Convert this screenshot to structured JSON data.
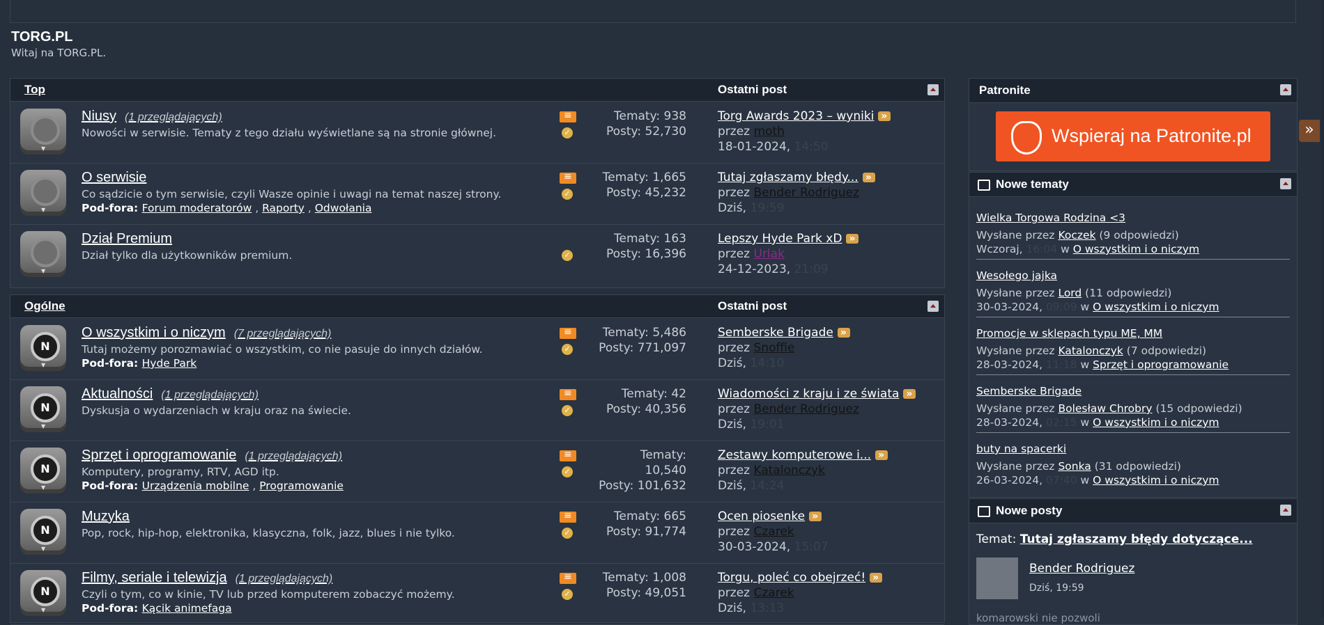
{
  "site": {
    "title": "TORG.PL",
    "subtitle": "Witaj na TORG.PL."
  },
  "sections": [
    {
      "title": "Top",
      "last_post_header": "Ostatni post",
      "forums": [
        {
          "name": "Niusy",
          "viewers": "(1 przeglądających)",
          "desc": "Nowości w serwisie. Tematy z tego działu wyświetlane są na stronie głównej.",
          "subforums_label": "",
          "subforums": [],
          "topics": "Tematy: 938",
          "posts": "Posty: 52,730",
          "last_title": "Torg Awards 2023 – wyniki",
          "by": "przez",
          "last_user": "moth",
          "last_date": "18-01-2024,",
          "last_time": "14:50",
          "has_rss": true,
          "new": false
        },
        {
          "name": "O serwisie",
          "viewers": "",
          "desc": "Co sądzicie o tym serwisie, czyli Wasze opinie i uwagi na temat naszej strony.",
          "subforums_label": "Pod-fora:",
          "subforums": [
            "Forum moderatorów",
            "Raporty",
            "Odwołania"
          ],
          "topics": "Tematy: 1,665",
          "posts": "Posty: 45,232",
          "last_title": "Tutaj zgłaszamy błędy...",
          "by": "przez",
          "last_user": "Bender Rodriguez",
          "last_date": "Dziś,",
          "last_time": "19:59",
          "has_rss": true,
          "new": false
        },
        {
          "name": "Dział Premium",
          "viewers": "",
          "desc": "Dział tylko dla użytkowników premium.",
          "subforums_label": "",
          "subforums": [],
          "topics": "Tematy: 163",
          "posts": "Posty: 16,396",
          "last_title": "Lepszy Hyde Park xD",
          "by": "przez",
          "last_user": "Urlak",
          "last_date": "24-12-2023,",
          "last_time": "21:09",
          "has_rss": false,
          "new": false
        }
      ]
    },
    {
      "title": "Ogólne",
      "last_post_header": "Ostatni post",
      "forums": [
        {
          "name": "O wszystkim i o niczym",
          "viewers": "(7 przeglądających)",
          "desc": "Tutaj możemy porozmawiać o wszystkim, co nie pasuje do innych działów.",
          "subforums_label": "Pod-fora:",
          "subforums": [
            "Hyde Park"
          ],
          "topics": "Tematy: 5,486",
          "posts": "Posty: 771,097",
          "last_title": "Semberske Brigade",
          "by": "przez",
          "last_user": "Snoffie",
          "last_date": "Dziś,",
          "last_time": "14:10",
          "has_rss": true,
          "new": true
        },
        {
          "name": "Aktualności",
          "viewers": "(1 przeglądających)",
          "desc": "Dyskusja o wydarzeniach w kraju oraz na świecie.",
          "subforums_label": "",
          "subforums": [],
          "topics": "Tematy: 42",
          "posts": "Posty: 40,356",
          "last_title": "Wiadomości z kraju i ze świata",
          "by": "przez",
          "last_user": "Bender Rodriguez",
          "last_date": "Dziś,",
          "last_time": "19:01",
          "has_rss": true,
          "new": true
        },
        {
          "name": "Sprzęt i oprogramowanie",
          "viewers": "(1 przeglądających)",
          "desc": "Komputery, programy, RTV, AGD itp.",
          "subforums_label": "Pod-fora:",
          "subforums": [
            "Urządzenia mobilne",
            "Programowanie"
          ],
          "topics": "Tematy: 10,540",
          "posts": "Posty: 101,632",
          "last_title": "Zestawy komputerowe i...",
          "by": "przez",
          "last_user": "Katalonczyk",
          "last_date": "Dziś,",
          "last_time": "14:24",
          "has_rss": true,
          "new": true
        },
        {
          "name": "Muzyka",
          "viewers": "",
          "desc": "Pop, rock, hip-hop, elektronika, klasyczna, folk, jazz, blues i nie tylko.",
          "subforums_label": "",
          "subforums": [],
          "topics": "Tematy: 665",
          "posts": "Posty: 91,774",
          "last_title": "Ocen piosenke",
          "by": "przez",
          "last_user": "Czarek",
          "last_date": "30-03-2024,",
          "last_time": "15:07",
          "has_rss": true,
          "new": true
        },
        {
          "name": "Filmy, seriale i telewizja",
          "viewers": "(1 przeglądających)",
          "desc": "Czyli o tym, co w kinie, TV lub przed komputerem zobaczyć możemy.",
          "subforums_label": "Pod-fora:",
          "subforums": [
            "Kącik animefaga"
          ],
          "topics": "Tematy: 1,008",
          "posts": "Posty: 49,051",
          "last_title": "Torgu, poleć co obejrzeć!",
          "by": "przez",
          "last_user": "Czarek",
          "last_date": "Dziś,",
          "last_time": "13:13",
          "has_rss": true,
          "new": true
        }
      ]
    }
  ],
  "sidebar": {
    "patronite": {
      "title": "Patronite",
      "button_label": "Wspieraj na Patronite.pl"
    },
    "new_topics": {
      "title": "Nowe tematy",
      "items": [
        {
          "title": "Wielka Torgowa Rodzina <3",
          "posted_by": "Wysłane przez",
          "user": "Koczek",
          "replies": "(9 odpowiedzi)",
          "date": "Wczoraj,",
          "time": "16:04",
          "in": "w",
          "forum": "O wszystkim i o niczym"
        },
        {
          "title": "Wesołego jajka",
          "posted_by": "Wysłane przez",
          "user": "Lord",
          "replies": "(11 odpowiedzi)",
          "date": "30-03-2024,",
          "time": "09:09",
          "in": "w",
          "forum": "O wszystkim i o niczym"
        },
        {
          "title": "Promocje w sklepach typu ME, MM",
          "posted_by": "Wysłane przez",
          "user": "Katalonczyk",
          "replies": "(7 odpowiedzi)",
          "date": "28-03-2024,",
          "time": "11:18",
          "in": "w",
          "forum": "Sprzęt i oprogramowanie"
        },
        {
          "title": "Semberske Brigade",
          "posted_by": "Wysłane przez",
          "user": "Bolesław Chrobry",
          "replies": "(15 odpowiedzi)",
          "date": "28-03-2024,",
          "time": "02:15",
          "in": "w",
          "forum": "O wszystkim i o niczym"
        },
        {
          "title": "buty na spacerki",
          "posted_by": "Wysłane przez",
          "user": "Sonka",
          "replies": "(31 odpowiedzi)",
          "date": "26-03-2024,",
          "time": "07:40",
          "in": "w",
          "forum": "O wszystkim i o niczym"
        }
      ]
    },
    "new_posts": {
      "title": "Nowe posty",
      "topic_label": "Temat:",
      "topic": "Tutaj zgłaszamy błędy dotyczące...",
      "user": "Bender Rodriguez",
      "date": "Dziś, 19:59",
      "excerpt": "komarowski nie pozwoli"
    }
  },
  "colors": {
    "background": "#26303d",
    "header": "#1c2430",
    "patronite": "#f05423",
    "rss": "#f08a24"
  }
}
